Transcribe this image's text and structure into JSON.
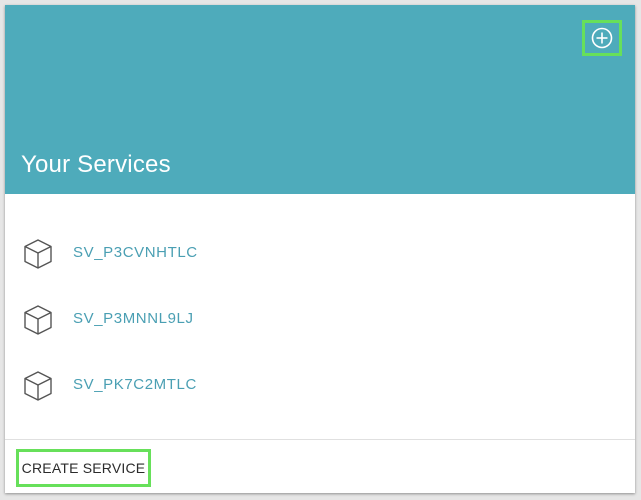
{
  "header": {
    "title": "Your Services",
    "add_icon": "plus-circle-icon",
    "color": "#4eabbb"
  },
  "services": [
    {
      "name": "SV_P3CVNHTLC",
      "icon": "cube-icon"
    },
    {
      "name": "SV_P3MNNL9LJ",
      "icon": "cube-icon"
    },
    {
      "name": "SV_PK7C2MTLC",
      "icon": "cube-icon"
    }
  ],
  "footer": {
    "create_label": "CREATE SERVICE"
  },
  "colors": {
    "accent": "#4eabbb",
    "link": "#4a9fb3",
    "highlight": "#67e05a"
  }
}
